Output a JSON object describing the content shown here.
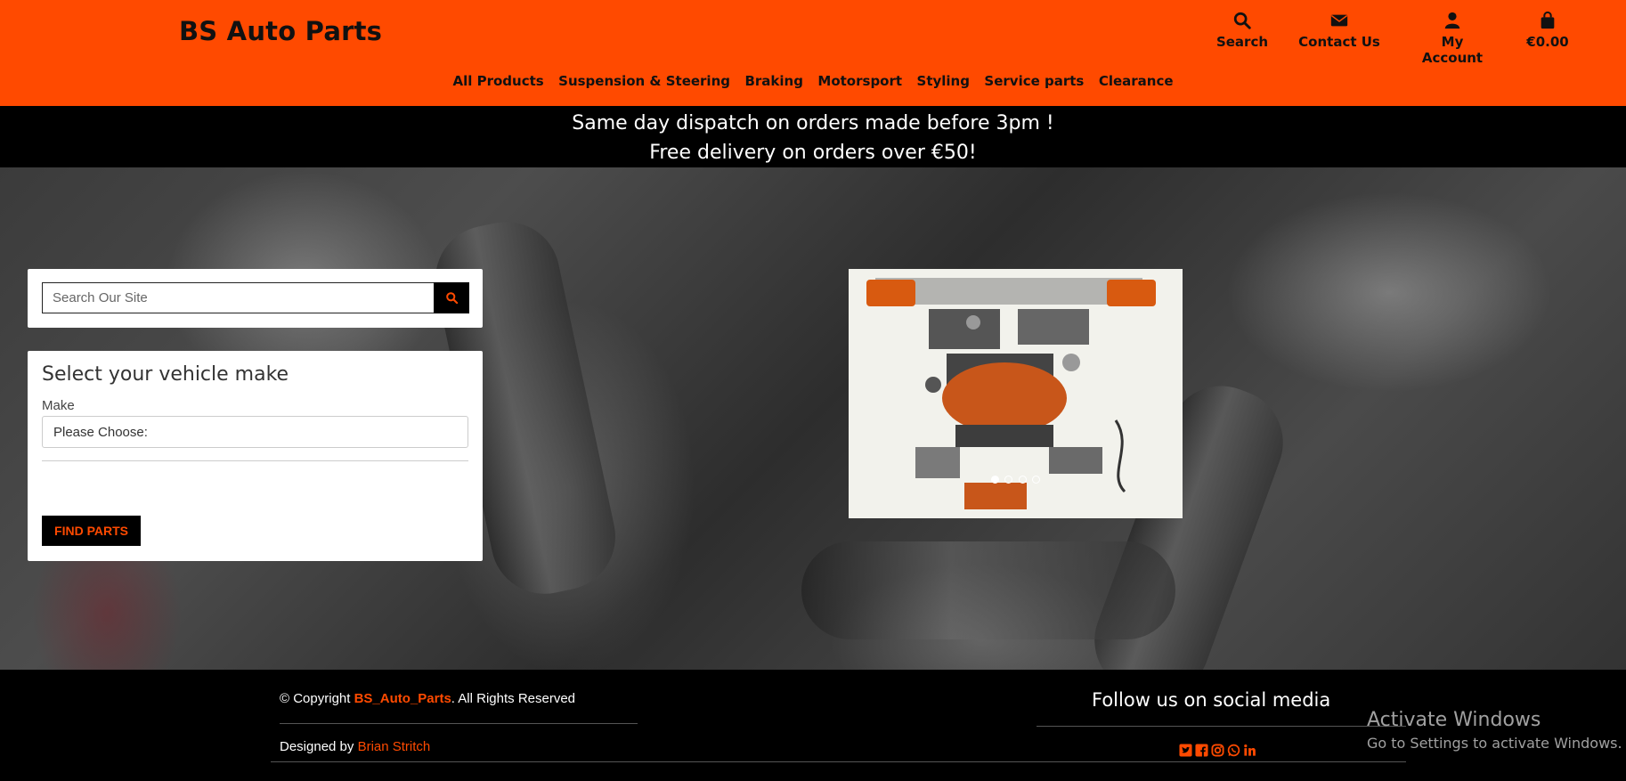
{
  "header": {
    "brand": "BS Auto Parts",
    "icons": [
      {
        "label": "Search",
        "icon": "search-icon"
      },
      {
        "label": "Contact Us",
        "icon": "envelope-icon"
      },
      {
        "label": "My Account",
        "icon": "user-icon"
      },
      {
        "label": "€0.00",
        "icon": "shopping-bag-icon"
      }
    ],
    "nav": [
      "All Products",
      "Suspension & Steering",
      "Braking",
      "Motorsport",
      "Styling",
      "Service parts",
      "Clearance"
    ]
  },
  "promo": {
    "line1": "Same day dispatch on orders made before 3pm !",
    "line2": "Free delivery on orders over €50!"
  },
  "search": {
    "placeholder": "Search Our Site"
  },
  "vehicle": {
    "title": "Select your vehicle make",
    "make_label": "Make",
    "make_value": "Please Choose:",
    "find_button": "FIND PARTS"
  },
  "slider": {
    "slide_count": 4,
    "active_index": 0
  },
  "footer": {
    "copyright_prefix": "© Copyright ",
    "copyright_name": "BS_Auto_Parts",
    "copyright_suffix": ". All Rights Reserved",
    "designed_prefix": "Designed by ",
    "designer": "Brian Stritch",
    "follow": "Follow us on social media",
    "socials": [
      "twitter-icon",
      "facebook-icon",
      "instagram-icon",
      "whatsapp-icon",
      "linkedin-icon"
    ]
  },
  "watermark": {
    "line1": "Activate Windows",
    "line2": "Go to Settings to activate Windows."
  },
  "colors": {
    "accent": "#ff4a00",
    "dark": "#000000",
    "text": "#111111"
  }
}
